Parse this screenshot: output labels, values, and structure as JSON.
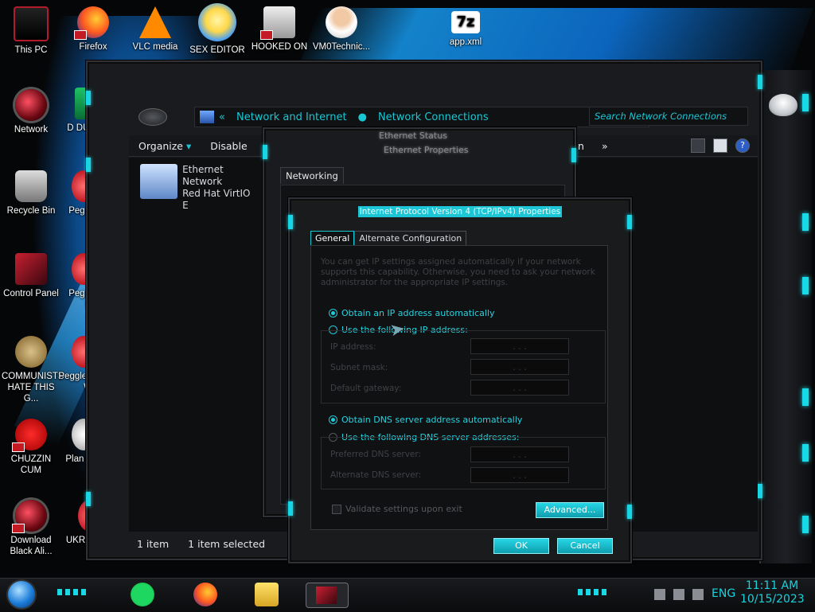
{
  "desktop": {
    "icons": [
      {
        "label": "This PC"
      },
      {
        "label": "Firefox"
      },
      {
        "label": "VLC media"
      },
      {
        "label": "SEX EDITOR"
      },
      {
        "label": "HOOKED ON"
      },
      {
        "label": "VM0Technic..."
      },
      {
        "label": "app.xml"
      },
      {
        "label": "Network"
      },
      {
        "label": "Recycle Bin"
      },
      {
        "label": "Control Panel"
      },
      {
        "label": "COMMUNISTS HATE THIS G..."
      },
      {
        "label": "CHUZZIN CUM"
      },
      {
        "label": "Download Black Ali..."
      },
      {
        "label": "Peggle"
      },
      {
        "label": "Peggle De"
      },
      {
        "label": "Peggle of Wa"
      },
      {
        "label": "Plan Zo"
      },
      {
        "label": "UKRAINE"
      },
      {
        "label": "D DUM"
      }
    ],
    "seven_zip_glyph": "7z"
  },
  "explorer": {
    "breadcrumb": [
      "Network and Internet",
      "Network Connections"
    ],
    "breadcrumb_prefix": "«",
    "search_placeholder": "Search Network Connections",
    "toolbar": {
      "organize": "Organize",
      "organize_arrow": "▾",
      "disable": "Disable",
      "overflow_fragment": "n",
      "more": "»"
    },
    "item": {
      "name": "Ethernet",
      "status": "Network",
      "adapter": "Red Hat VirtIO E"
    },
    "status": {
      "count": "1 item",
      "selected": "1 item selected"
    }
  },
  "ethernet_properties": {
    "ghost_title_1": "Ethernet Status",
    "ghost_title_2": "Ethernet Properties",
    "tab": "Networking"
  },
  "ipv4": {
    "title": "Internet Protocol Version 4 (TCP/IPv4) Properties",
    "tabs": [
      "General",
      "Alternate Configuration"
    ],
    "intro": "You can get IP settings assigned automatically if your network supports this capability. Otherwise, you need to ask your network administrator for the appropriate IP settings.",
    "ip_auto": "Obtain an IP address automatically",
    "ip_manual": "Use the following IP address:",
    "fields_ip": [
      {
        "label": "IP address:",
        "value": ". . ."
      },
      {
        "label": "Subnet mask:",
        "value": ". . ."
      },
      {
        "label": "Default gateway:",
        "value": ". . ."
      }
    ],
    "dns_auto": "Obtain DNS server address automatically",
    "dns_manual": "Use the following DNS server addresses:",
    "fields_dns": [
      {
        "label": "Preferred DNS server:",
        "value": ". . ."
      },
      {
        "label": "Alternate DNS server:",
        "value": ". . ."
      }
    ],
    "validate": "Validate settings upon exit",
    "advanced": "Advanced...",
    "ok": "OK",
    "cancel": "Cancel",
    "ip_auto_selected": true,
    "dns_auto_selected": true
  },
  "taskbar": {
    "language": "ENG",
    "time": "11:11 AM",
    "date": "10/15/2023"
  },
  "colors": {
    "accent": "#19d4e3",
    "chrome": "#1a1b1e",
    "alien_red": "#c41a24"
  }
}
